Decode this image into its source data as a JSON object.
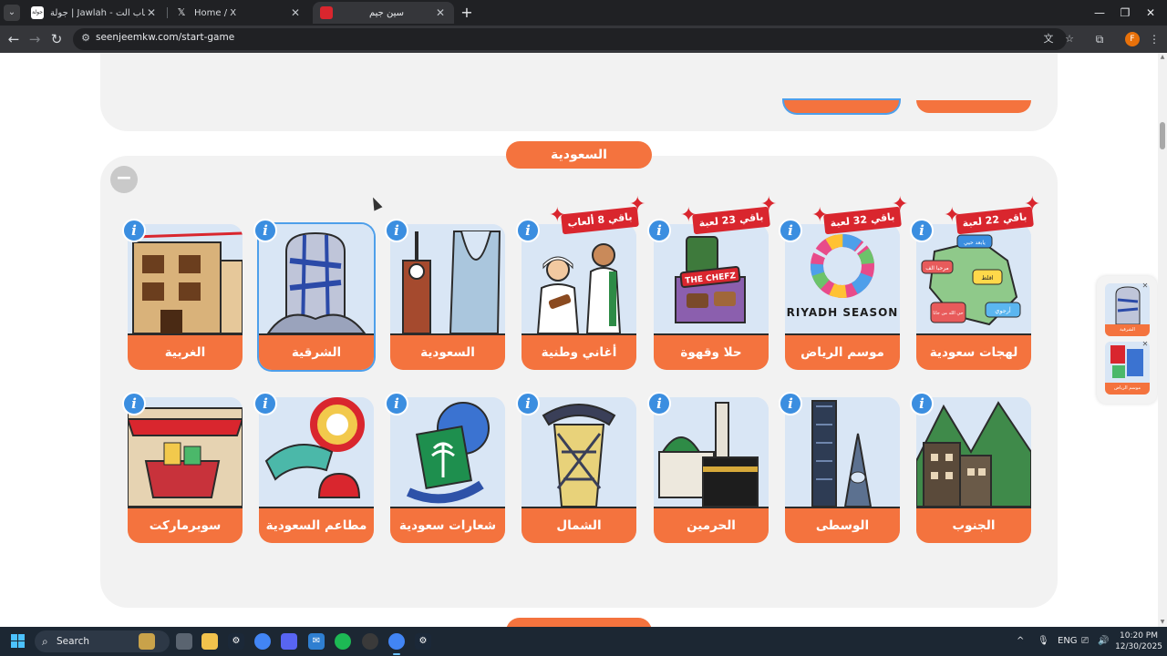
{
  "browser": {
    "tabs": [
      {
        "title": "جولة | Jawlah - منصة الألعاب الت",
        "favicon_text": "جولة",
        "active": false
      },
      {
        "title": "Home / X",
        "favicon_text": "𝕏",
        "active": false
      },
      {
        "title": "سين جيم",
        "favicon_text": "",
        "active": true
      }
    ],
    "url": "seenjeemkw.com/start-game",
    "profile_initial": "F"
  },
  "page": {
    "section_title": "السعودية",
    "collapse_symbol": "−",
    "info_symbol": "i",
    "cards_row1": [
      {
        "label": "لهجات سعودية",
        "ribbon": "باقي 22 لعبة",
        "art": "dialects-map-icon"
      },
      {
        "label": "موسم الرياض",
        "ribbon": "باقي 32 لعبة",
        "art": "riyadh-season-logo",
        "art_text": "RIYADH SEASON"
      },
      {
        "label": "حلا وقهوة",
        "ribbon": "باقي 23 لعبة",
        "art": "coffee-sweets-icon",
        "art_text": "THE CHEFZ"
      },
      {
        "label": "أغاني وطنية",
        "ribbon": "باقي 8 ألعاب",
        "art": "singers-icon"
      },
      {
        "label": "السعودية",
        "ribbon": "",
        "art": "kingdom-tower-icon"
      },
      {
        "label": "الشرقية",
        "ribbon": "",
        "art": "dhahran-tower-icon",
        "selected": true
      },
      {
        "label": "الغربية",
        "ribbon": "",
        "art": "hijazi-house-icon"
      }
    ],
    "cards_row2": [
      {
        "label": "الجنوب",
        "art": "southern-mountains-icon"
      },
      {
        "label": "الوسطى",
        "art": "riyadh-towers-icon"
      },
      {
        "label": "الحرمين",
        "art": "holy-mosques-icon"
      },
      {
        "label": "الشمال",
        "art": "northern-tower-icon"
      },
      {
        "label": "شعارات سعودية",
        "art": "saudi-emblem-icon"
      },
      {
        "label": "مطاعم السعودية",
        "art": "restaurants-icon"
      },
      {
        "label": "سوبرماركت",
        "art": "supermarket-icon"
      }
    ],
    "dialect_bubbles": [
      "يابعد حيي",
      "مرحبا الف",
      "اقلط",
      "أرجوي",
      "حي الله من جانا"
    ],
    "side_panel": [
      {
        "label": "الشرقية"
      },
      {
        "label": "موسم الرياض"
      }
    ]
  },
  "taskbar": {
    "search_label": "Search",
    "lang": "ENG",
    "time": "10:20 PM",
    "date": "12/30/2025"
  },
  "colors": {
    "accent_orange": "#f4733e",
    "info_blue": "#3b8ee0",
    "ribbon_red": "#d9262e",
    "section_bg": "#f2f2f2"
  }
}
